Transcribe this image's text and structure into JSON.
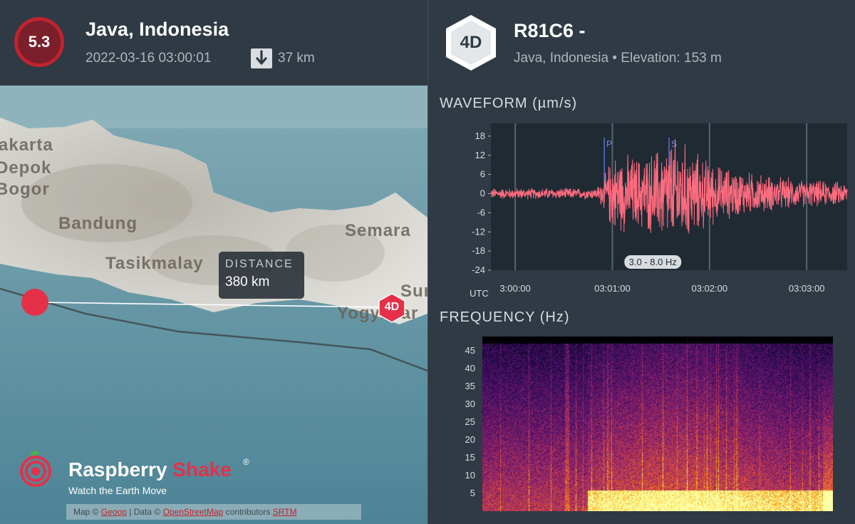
{
  "earthquake": {
    "magnitude": "5.3",
    "location": "Java, Indonesia",
    "datetime": "2022-03-16 03:00:01",
    "depth": "37 km",
    "depth_icon": "arrow-down-icon"
  },
  "map": {
    "cities": [
      {
        "name": "akarta"
      },
      {
        "name": "Depok"
      },
      {
        "name": "Bogor"
      },
      {
        "name": "Bandung"
      },
      {
        "name": "Tasikmalay"
      },
      {
        "name": "Semara"
      },
      {
        "name": "Sur"
      },
      {
        "name": "Yogyakar"
      }
    ],
    "distance_label": "DISTANCE",
    "distance_value": "380 km",
    "station_marker_label": "4D",
    "attribution": {
      "prefix": "Map ©",
      "link1": "Geoop",
      "mid": "| Data ©",
      "link2": "OpenStreetMap",
      "suffix": "contributors",
      "link3": "SRTM"
    },
    "colors": {
      "epicenter": "#e5304a",
      "station": "#e5304a"
    }
  },
  "brand": {
    "name_a": "Raspberry ",
    "name_b": "Shake",
    "reg": "®",
    "tagline": "Watch the Earth Move",
    "accent": "#e5304a"
  },
  "station": {
    "badge": "4D",
    "code": "R81C6  -",
    "subtitle": "Java, Indonesia • Elevation: 153 m"
  },
  "chart_data": [
    {
      "type": "line",
      "title": "WAVEFORM  (µm/s)",
      "x_ticks": [
        "3:00:00",
        "03:01:00",
        "03:02:00",
        "03:03:00"
      ],
      "x_unit_label": "UTC",
      "y_ticks": [
        18,
        12,
        6,
        0,
        -6,
        -12,
        -18,
        -24
      ],
      "ylim": [
        -24,
        22
      ],
      "xlim_seconds": [
        -15,
        205
      ],
      "markers": [
        {
          "label": "P",
          "t": 55
        },
        {
          "label": "S",
          "t": 95
        }
      ],
      "filter_label": "3.0 - 8.0 Hz",
      "envelope": [
        {
          "t": -15,
          "amp": 2.0
        },
        {
          "t": 50,
          "amp": 2.0
        },
        {
          "t": 55,
          "amp": 6
        },
        {
          "t": 60,
          "amp": 14
        },
        {
          "t": 80,
          "amp": 13
        },
        {
          "t": 90,
          "amp": 17
        },
        {
          "t": 100,
          "amp": 20
        },
        {
          "t": 110,
          "amp": 15
        },
        {
          "t": 125,
          "amp": 10
        },
        {
          "t": 150,
          "amp": 7
        },
        {
          "t": 175,
          "amp": 5
        },
        {
          "t": 205,
          "amp": 4
        }
      ],
      "color": "#ff6b7f"
    },
    {
      "type": "heatmap",
      "title": "FREQUENCY  (Hz)",
      "y_ticks": [
        45,
        40,
        35,
        30,
        25,
        20,
        15,
        10,
        5
      ],
      "ylim": [
        0,
        49
      ],
      "colormap": "inferno"
    }
  ]
}
